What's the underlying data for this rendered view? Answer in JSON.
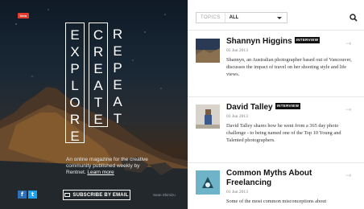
{
  "hero": {
    "badge": "New",
    "explore": [
      "E",
      "X",
      "P",
      "L",
      "O",
      "R",
      "E"
    ],
    "create": [
      "C",
      "R",
      "E",
      "A",
      "T",
      "E"
    ],
    "repeat": [
      "R",
      "E",
      "P",
      "E",
      "A",
      "T"
    ],
    "tagline": "An online magazine for the creative community published weekly by Rentnet.",
    "tagline_link": "Learn more",
    "subscribe": "SUBSCRIBE BY EMAIL",
    "credit": "Sean Shimizu",
    "social": [
      "f",
      "t"
    ]
  },
  "filter": {
    "label": "TOPICS",
    "value": "ALL"
  },
  "articles": [
    {
      "title": "Shannyn Higgins",
      "badge": "INTERVIEW",
      "date": "05 Jun 2013",
      "description": "Shannyn, an Australian photographer based out of Vancouver, discusses the impact of travel on her shooting style and life views."
    },
    {
      "title": "David Talley",
      "badge": "INTERVIEW",
      "date": "03 Jun 2013",
      "description": "David Talley shares how he went from a 365 day photo challenge - to being named one of the Top 10 Young and Talented photographers."
    },
    {
      "title": "Common Myths About Freelancing",
      "badge": "",
      "date": "01 Jun 2013",
      "description": "Some of the most common misconceptions about"
    }
  ],
  "colors": {
    "accent_red": "#e43a2c",
    "facebook": "#2f6fb8",
    "twitter": "#1da1f2"
  }
}
